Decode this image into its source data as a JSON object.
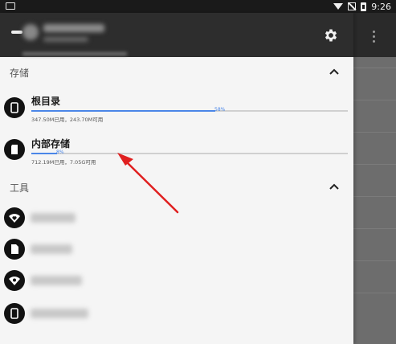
{
  "status_bar": {
    "time": "9:26",
    "icons": [
      "screenshot-icon",
      "wifi-icon",
      "no-sim-icon",
      "battery-icon"
    ]
  },
  "header": {
    "icons": [
      "back-icon",
      "moon-icon",
      "gear-icon",
      "overflow-menu-icon"
    ]
  },
  "storage_section": {
    "title": "存储",
    "items": [
      {
        "name": "根目录",
        "percent_label": "58%",
        "used_fraction": 0.58,
        "usage": "347.50M已用，243.70M可用",
        "icon": "phone-icon"
      },
      {
        "name": "内部存储",
        "percent_label": "8%",
        "used_fraction": 0.08,
        "usage": "712.19M已用，7.05G可用",
        "icon": "sd-card-icon"
      }
    ]
  },
  "tools_section": {
    "title": "工具",
    "items": [
      {
        "icon": "wifi-heart-icon"
      },
      {
        "icon": "file-icon"
      },
      {
        "icon": "remote-access-icon"
      },
      {
        "icon": "phone-icon"
      }
    ]
  },
  "colors": {
    "accent": "#4a86e8",
    "arrow": "#e02020",
    "header": "#2d2d2d",
    "drawer": "#f5f5f5"
  }
}
